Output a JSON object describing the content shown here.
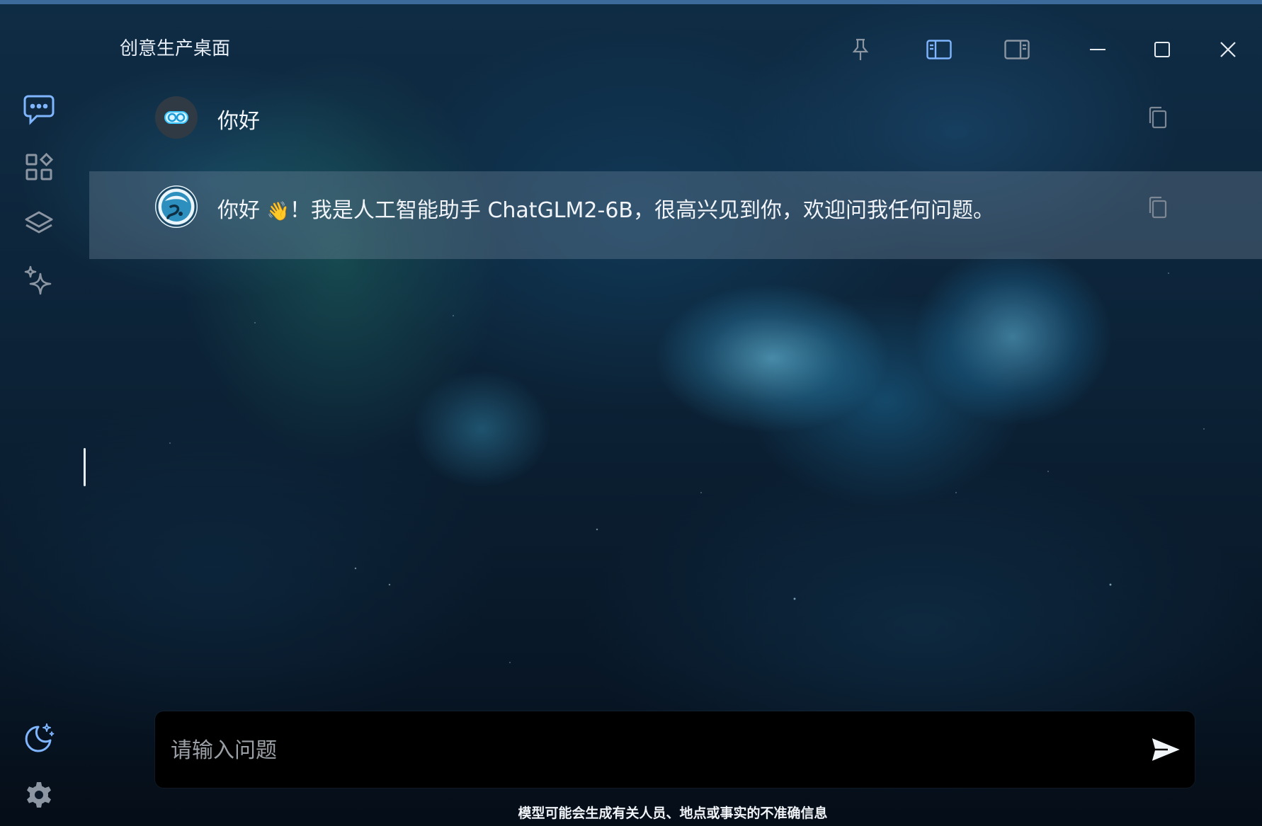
{
  "app": {
    "title": "创意生产桌面"
  },
  "titlebar": {
    "buttons": [
      {
        "name": "pin-icon"
      },
      {
        "name": "left-panel-icon"
      },
      {
        "name": "right-panel-icon"
      },
      {
        "name": "minimize-icon"
      },
      {
        "name": "maximize-icon"
      },
      {
        "name": "close-icon"
      }
    ]
  },
  "sidebar": {
    "items": [
      {
        "name": "chat-icon",
        "active": true
      },
      {
        "name": "apps-icon",
        "active": false
      },
      {
        "name": "layers-icon",
        "active": false
      },
      {
        "name": "sparkles-icon",
        "active": false
      }
    ],
    "bottom": [
      {
        "name": "dark-mode-icon"
      },
      {
        "name": "settings-icon"
      }
    ]
  },
  "chat": {
    "messages": [
      {
        "role": "user",
        "text": "你好"
      },
      {
        "role": "assistant",
        "text_before": "你好 ",
        "emoji": "👋",
        "text_after": "！我是人工智能助手 ChatGLM2-6B，很高兴见到你，欢迎问我任何问题。"
      }
    ]
  },
  "input": {
    "placeholder": "请输入问题",
    "value": ""
  },
  "footer": {
    "disclaimer": "模型可能会生成有关人员、地点或事实的不准确信息"
  },
  "colors": {
    "accent": "#7fb6ff",
    "icon_muted": "#8c96a3"
  }
}
